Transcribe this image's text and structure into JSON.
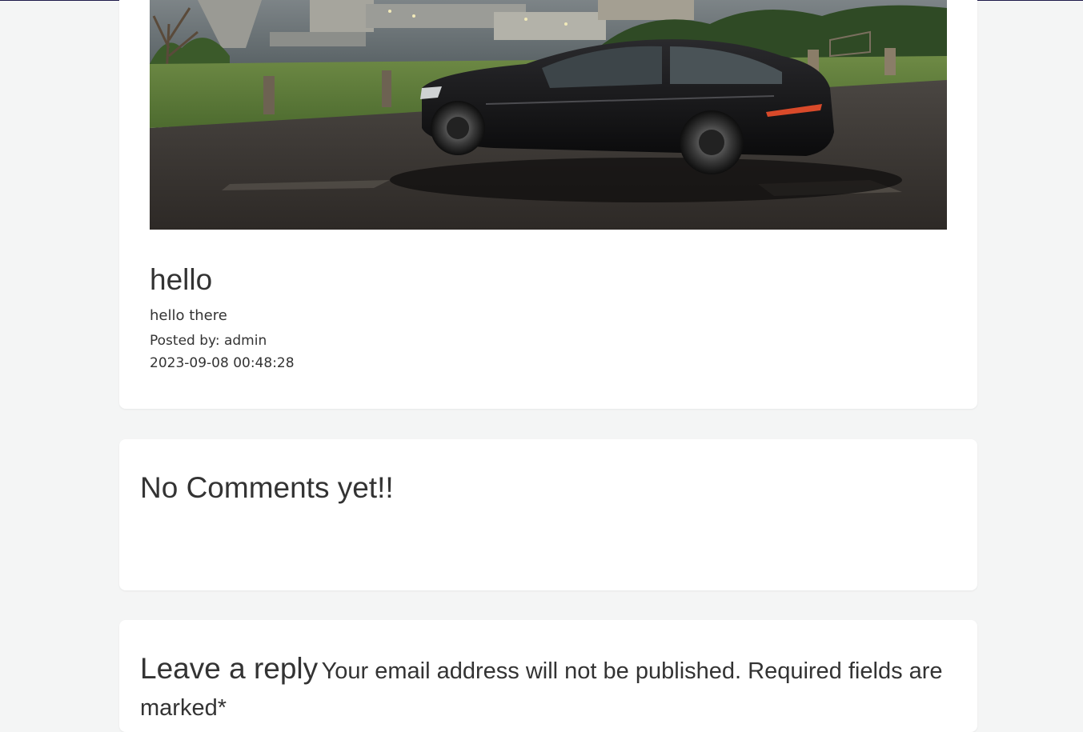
{
  "post": {
    "image_alt": "black sports car parked on wet pavement overlooking a harbor",
    "title": "hello",
    "body": "hello there",
    "posted_by": "Posted by: admin",
    "date": "2023-09-08 00:48:28"
  },
  "comments": {
    "heading": "No Comments yet!!"
  },
  "reply": {
    "title": "Leave a reply",
    "note": "Your email address will not be published. Required fields are marked*"
  },
  "colors": {
    "page_background": "#f4f5f5",
    "card_background": "#ffffff",
    "text": "#333333",
    "top_bar": "#1e1a4a"
  }
}
